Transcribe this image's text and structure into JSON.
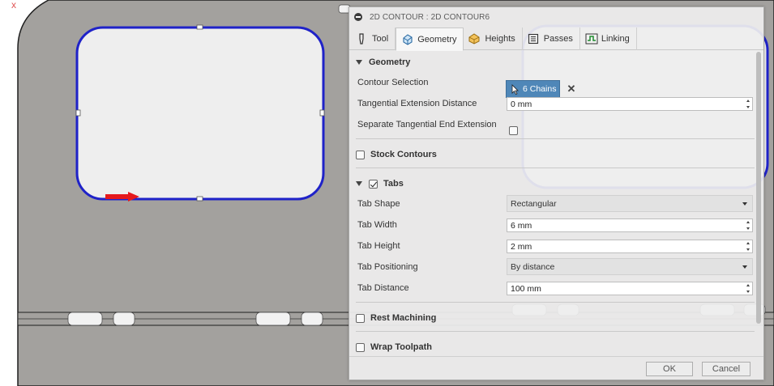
{
  "viewport": {
    "x_marker": "x"
  },
  "dialog": {
    "title": "2D CONTOUR : 2D CONTOUR6",
    "tabs": [
      {
        "label": "Tool",
        "icon": "tool-icon"
      },
      {
        "label": "Geometry",
        "icon": "geometry-icon",
        "active": true
      },
      {
        "label": "Heights",
        "icon": "heights-icon"
      },
      {
        "label": "Passes",
        "icon": "passes-icon"
      },
      {
        "label": "Linking",
        "icon": "linking-icon"
      }
    ],
    "geometry": {
      "section_label": "Geometry",
      "contour_selection_label": "Contour Selection",
      "chains_button": "6 Chains",
      "tangential_extension_label": "Tangential Extension Distance",
      "tangential_extension_value": "0 mm",
      "separate_end_extension_label": "Separate Tangential End Extension",
      "separate_end_extension_checked": false
    },
    "stock_contours": {
      "label": "Stock Contours",
      "checked": false
    },
    "tabs_section": {
      "label": "Tabs",
      "checked": true,
      "shape_label": "Tab Shape",
      "shape_value": "Rectangular",
      "width_label": "Tab Width",
      "width_value": "6 mm",
      "height_label": "Tab Height",
      "height_value": "2 mm",
      "positioning_label": "Tab Positioning",
      "positioning_value": "By distance",
      "distance_label": "Tab Distance",
      "distance_value": "100 mm"
    },
    "rest_machining": {
      "label": "Rest Machining",
      "checked": false
    },
    "wrap_toolpath": {
      "label": "Wrap Toolpath",
      "checked": false
    },
    "footer": {
      "ok_label": "OK",
      "cancel_label": "Cancel"
    },
    "colors": {
      "accent": "#4f87b8",
      "contour_blue": "#1f22c8",
      "part_gray": "#a09e9b",
      "direction_arrow": "#e5191c"
    }
  }
}
